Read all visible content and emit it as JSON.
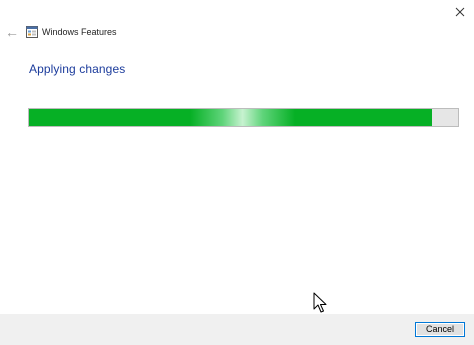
{
  "window": {
    "title": "Windows Features",
    "icon": "windows-features-icon"
  },
  "titlebar": {
    "back_icon": "back-arrow-icon",
    "close_icon": "close-icon"
  },
  "main": {
    "heading": "Applying changes",
    "progress": {
      "value_fraction": 0.94,
      "color": "#06b025"
    }
  },
  "footer": {
    "cancel_label": "Cancel"
  },
  "colors": {
    "heading": "#1c3c9c",
    "accent": "#0078d7",
    "progress_green": "#06b025"
  }
}
